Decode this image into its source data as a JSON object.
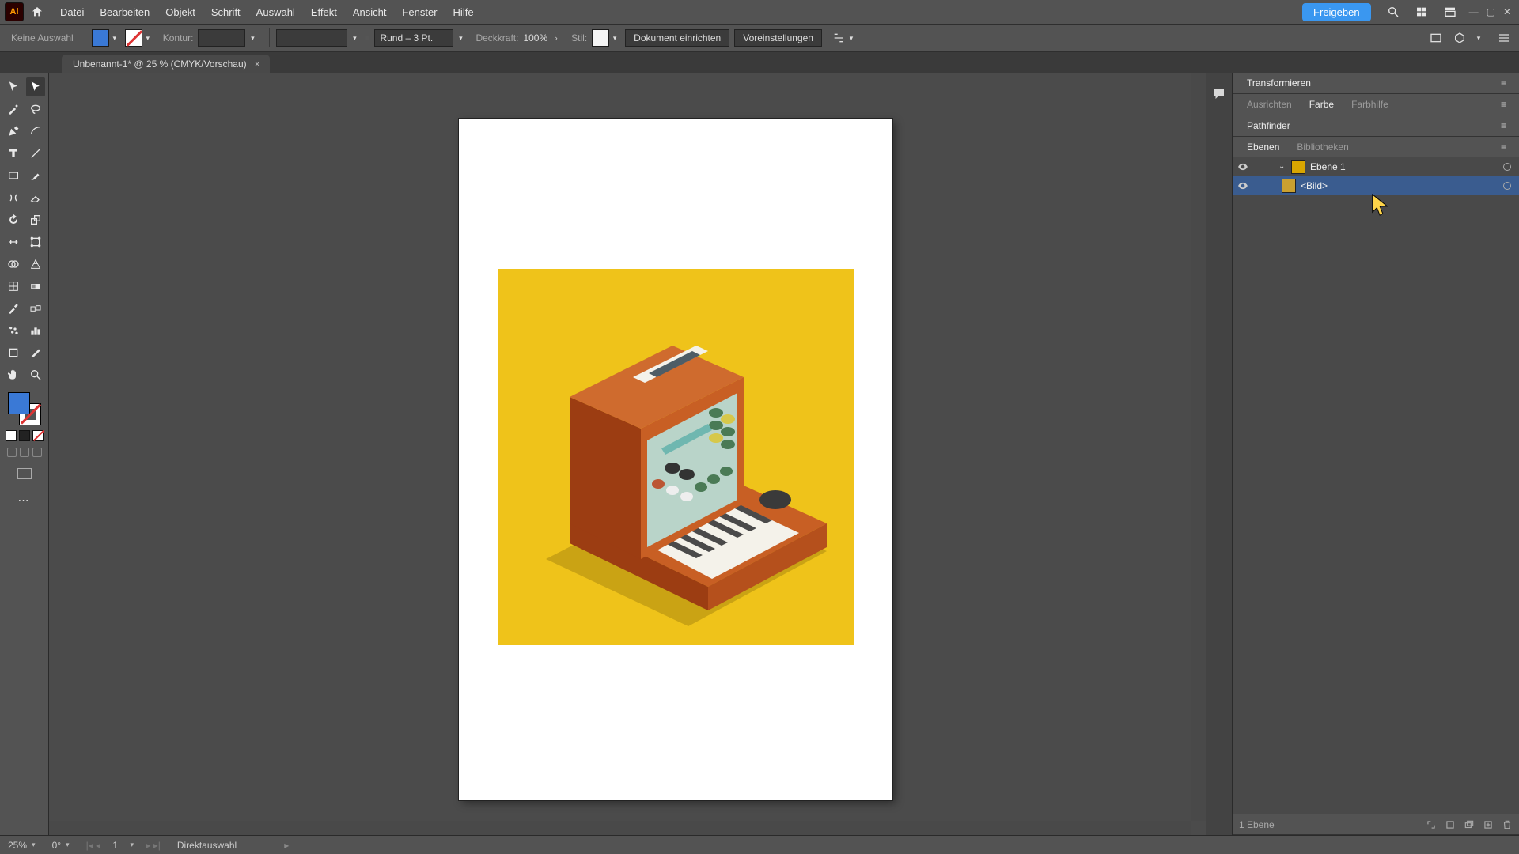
{
  "menu": {
    "items": [
      "Datei",
      "Bearbeiten",
      "Objekt",
      "Schrift",
      "Auswahl",
      "Effekt",
      "Ansicht",
      "Fenster",
      "Hilfe"
    ],
    "share": "Freigeben"
  },
  "controlbar": {
    "noSel": "Keine Auswahl",
    "konturLabel": "Kontur:",
    "konturVal": "",
    "brush": "Rund – 3 Pt.",
    "opacityLabel": "Deckkraft:",
    "opacityVal": "100%",
    "stilLabel": "Stil:",
    "docSetup": "Dokument einrichten",
    "prefs": "Voreinstellungen"
  },
  "tab": {
    "title": "Unbenannt-1* @ 25 % (CMYK/Vorschau)",
    "close": "×"
  },
  "panels": {
    "transform": "Transformieren",
    "align": "Ausrichten",
    "color": "Farbe",
    "colorGuide": "Farbhilfe",
    "pathfinder": "Pathfinder",
    "layers": "Ebenen",
    "libs": "Bibliotheken",
    "layer1": "Ebene 1",
    "image": "<Bild>",
    "footCount": "1 Ebene"
  },
  "status": {
    "zoom": "25%",
    "rotate": "0°",
    "artboard": "1",
    "tool": "Direktauswahl"
  }
}
